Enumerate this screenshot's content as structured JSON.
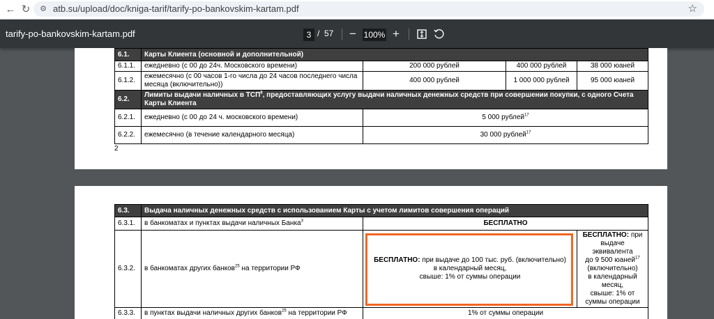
{
  "browser": {
    "url": "atb.su/upload/doc/kniga-tarif/tarify-po-bankovskim-kartam.pdf",
    "back_icon": "arrow-left",
    "reload_icon": "reload",
    "site_info_icon": "tune",
    "bookmark_icon": "star-outline"
  },
  "pdf_toolbar": {
    "title": "tarify-po-bankovskim-kartam.pdf",
    "current_page": "3",
    "separator": "/",
    "total_pages": "57",
    "zoom": "100%",
    "zoom_out_icon": "minus",
    "zoom_in_icon": "plus",
    "fit_icon": "fit-to-page",
    "rotate_icon": "rotate"
  },
  "page_a": {
    "rows": [
      {
        "num": "6.1.",
        "text": "Карты Клиента (основной и дополнительной)"
      },
      {
        "num": "6.1.1.",
        "text": "ежедневно (с 00 до 24ч. Московского времени)",
        "c1": "200 000 рублей",
        "c2": "400 000 рублей",
        "c3": "38 000 юаней"
      },
      {
        "num": "6.1.2.",
        "text": "ежемесячно (с 00 часов 1-го числа до 24 часов последнего числа месяца (включительно))",
        "c1": "400 000 рублей",
        "c2": "1 000 000 рублей",
        "c3": "95 000 юаней"
      },
      {
        "num": "6.2.",
        "text_before": "Лимиты выдачи наличных в ТСП",
        "sup": "8",
        "text_after": ", предоставляющих услугу выдачи наличных денежных средств при совершении покупки, с одного Счета Карты Клиента"
      },
      {
        "num": "6.2.1.",
        "text": "ежедневно (с 00 до 24 ч. московского времени)",
        "value": "5 000 рублей",
        "sup": "17"
      },
      {
        "num": "6.2.2.",
        "text": "ежемесячно (в течение календарного месяца)",
        "value": "30 000 рублей",
        "sup": "17"
      }
    ],
    "page_number": "2"
  },
  "page_b": {
    "rows": [
      {
        "num": "6.3.",
        "text": "Выдача наличных денежных средств с использованием Карты с учетом лимитов совершения операций"
      },
      {
        "num": "6.3.1.",
        "text": "в банкоматах и пунктах выдачи наличных Банка",
        "sup": "3",
        "value": "БЕСПЛАТНО"
      },
      {
        "num": "6.3.2.",
        "text": "в банкоматах других банков",
        "sup": "25",
        "text_after": " на территории РФ",
        "mid_bold": "БЕСПЛАТНО:",
        "mid_line1": " при выдаче до 100 тыс. руб. (включительно)",
        "mid_line2": "в календарный месяц,",
        "mid_line3": "свыше: 1% от суммы операции",
        "right_bold": "БЕСПЛАТНО:",
        "right_line1": " при",
        "right_line2": "выдаче эквивалента",
        "right_line3": "до 9 500 юаней",
        "right_sup": "17",
        "right_line4": "(включительно)",
        "right_line5": "в календарный",
        "right_line6": "месяц,",
        "right_line7": "свыше: 1% от",
        "right_line8": "суммы операции"
      },
      {
        "num": "6.3.3.",
        "text": "в пунктах выдачи наличных других банков",
        "sup": "25",
        "text_after": " на территории РФ",
        "value": "1% от суммы операции"
      }
    ]
  },
  "colors": {
    "highlight_border": "#f26522",
    "header_row_bg": "#3f3f3f",
    "viewer_bg": "#525659",
    "toolbar_bg": "#323639"
  }
}
